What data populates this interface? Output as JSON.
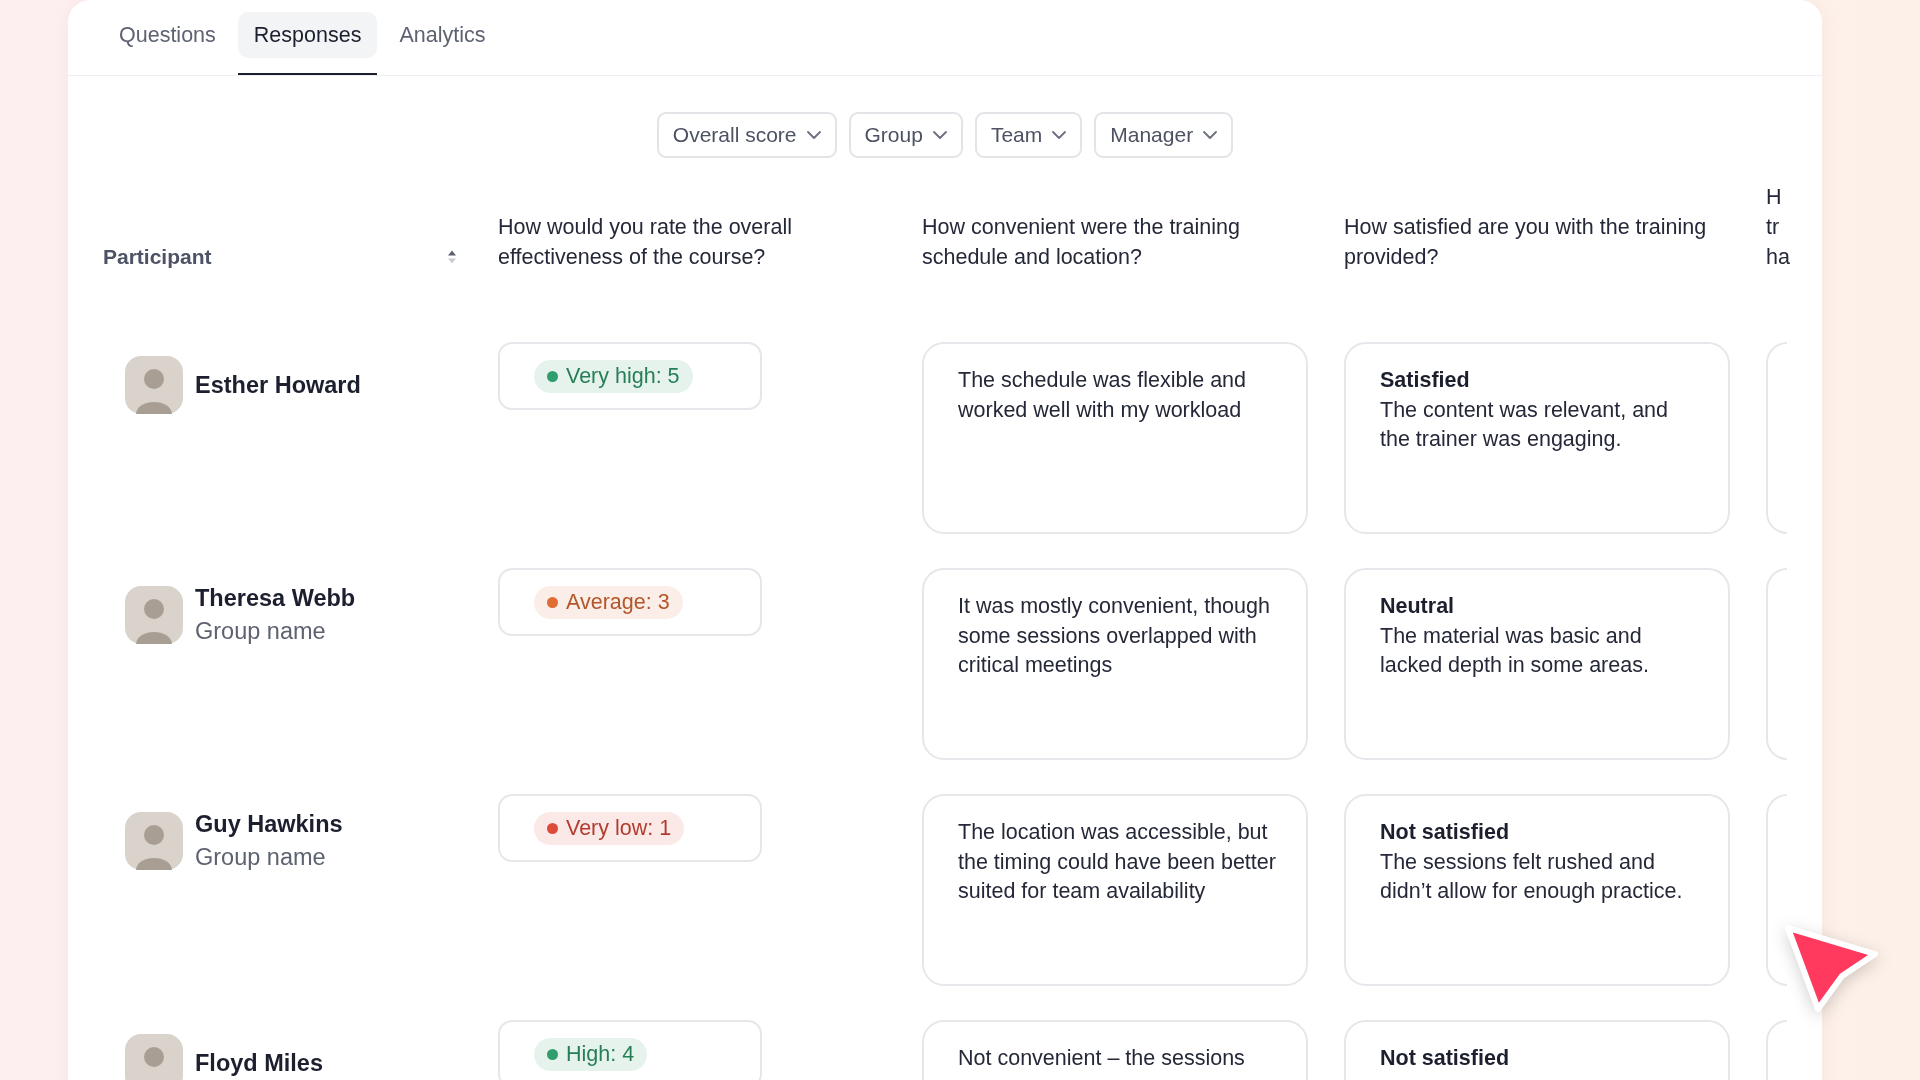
{
  "tabs": [
    {
      "label": "Questions",
      "selected": false
    },
    {
      "label": "Responses",
      "selected": true
    },
    {
      "label": "Analytics",
      "selected": false
    }
  ],
  "filters": [
    {
      "label": "Overall score"
    },
    {
      "label": "Group"
    },
    {
      "label": "Team"
    },
    {
      "label": "Manager"
    }
  ],
  "table": {
    "columns": [
      {
        "kind": "sortable",
        "label": "Participant"
      },
      {
        "kind": "question",
        "label": "How would you rate the overall effectiveness of the course?"
      },
      {
        "kind": "question",
        "label": "How convenient were the training schedule and location?"
      },
      {
        "kind": "question",
        "label": "How satisfied are you with the training provided?"
      },
      {
        "kind": "clipped",
        "lines": [
          "H",
          "tr",
          "ha"
        ]
      }
    ],
    "rows": [
      {
        "cells": [
          {
            "kind": "participant",
            "name": "Esther Howard"
          },
          {
            "kind": "score",
            "label": "Very high: 5",
            "color": "#2f9d6d"
          },
          {
            "kind": "text",
            "text": "The schedule was flexible and worked well with my workload"
          },
          {
            "kind": "rated",
            "title": "Satisfied",
            "text": "The content was relevant, and the trainer was engaging."
          },
          {
            "kind": "clipped"
          }
        ]
      },
      {
        "cells": [
          {
            "kind": "participant",
            "name": "Theresa Webb",
            "group": "Group name"
          },
          {
            "kind": "score",
            "label": "Average: 3",
            "color": "#e06b35"
          },
          {
            "kind": "text",
            "text": "It was mostly convenient, though some sessions overlapped with critical meetings"
          },
          {
            "kind": "rated",
            "title": "Neutral",
            "text": "The material was basic and lacked depth in some areas."
          },
          {
            "kind": "clipped"
          }
        ]
      },
      {
        "cells": [
          {
            "kind": "participant",
            "name": "Guy Hawkins",
            "group": "Group name"
          },
          {
            "kind": "score",
            "label": "Very low: 1",
            "color": "#dd4b3b"
          },
          {
            "kind": "text",
            "text": "The location was accessible, but the timing could have been better suited for team availability"
          },
          {
            "kind": "rated",
            "title": "Not satisfied",
            "text": "The sessions felt rushed and didn’t allow for enough practice."
          },
          {
            "kind": "clipped"
          }
        ]
      },
      {
        "cells": [
          {
            "kind": "participant",
            "name": "Floyd Miles"
          },
          {
            "kind": "score",
            "label": "High: 4",
            "color": "#2f9d6d"
          },
          {
            "kind": "text",
            "text": "Not convenient – the sessions"
          },
          {
            "kind": "rated",
            "title": "Not satisfied"
          },
          {
            "kind": "clipped"
          }
        ]
      }
    ]
  }
}
